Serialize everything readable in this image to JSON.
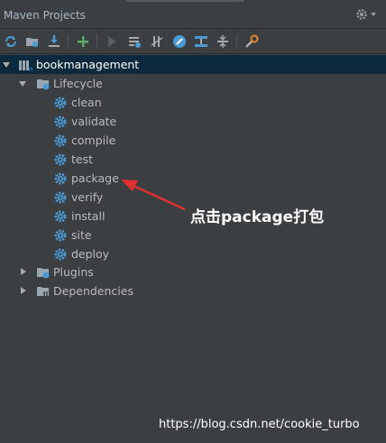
{
  "panel": {
    "title": "Maven Projects",
    "settings_icon": "gear-icon"
  },
  "toolbar": {
    "buttons": [
      {
        "icon": "reimport-icon"
      },
      {
        "icon": "generate-sources-icon"
      },
      {
        "icon": "download-icon"
      },
      {
        "icon": "add-icon"
      },
      {
        "icon": "run-icon"
      },
      {
        "icon": "execute-goal-icon"
      },
      {
        "icon": "toggle-offline-icon"
      },
      {
        "icon": "skip-tests-icon"
      },
      {
        "icon": "show-dependencies-icon"
      },
      {
        "icon": "collapse-all-icon"
      },
      {
        "icon": "settings-icon"
      }
    ]
  },
  "tree": {
    "project": "bookmanagement",
    "lifecycle": {
      "label": "Lifecycle",
      "goals": [
        "clean",
        "validate",
        "compile",
        "test",
        "package",
        "verify",
        "install",
        "site",
        "deploy"
      ]
    },
    "plugins": "Plugins",
    "dependencies": "Dependencies"
  },
  "annotation": {
    "text": "点击package打包"
  },
  "watermark": "https://blog.csdn.net/cookie_turbo",
  "colors": {
    "panel_bg": "#3c3f41",
    "selection": "#0d293e",
    "goal_icon": "#4a9ad4",
    "arrow": "#e03030"
  }
}
